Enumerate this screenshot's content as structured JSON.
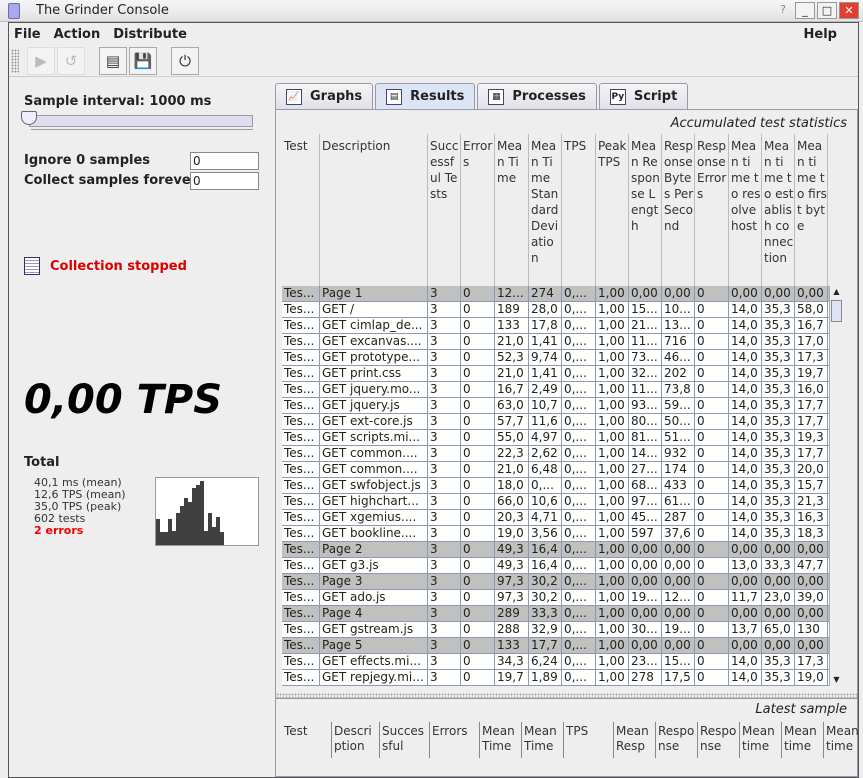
{
  "window": {
    "title": "The Grinder Console"
  },
  "menu": [
    "File",
    "Action",
    "Distribute"
  ],
  "help": "Help",
  "toolbar": [
    {
      "icon": "start-processes-icon",
      "enabled": false
    },
    {
      "icon": "reset-processes-icon",
      "enabled": false
    },
    {
      "icon": "start-recording-icon",
      "enabled": true
    },
    {
      "icon": "save-results-icon",
      "enabled": true
    },
    {
      "icon": "stop-icon",
      "enabled": true
    }
  ],
  "left": {
    "sample_interval": "Sample interval: 1000 ms",
    "slider_level": 0.05,
    "ignore_label": "Ignore 0 samples",
    "ignore_value": "0",
    "collect_label": "Collect samples forever",
    "collect_value": "0",
    "status": "Collection stopped",
    "status_color": "#dd0000",
    "tps": "0,00 TPS",
    "total_label": "Total",
    "stats": [
      "40,1 ms (mean)",
      "12,6 TPS (mean)",
      "35,0 TPS (peak)",
      "602 tests"
    ],
    "errors": "2 errors",
    "histogram": [
      0.4,
      0.2,
      0.2,
      0.4,
      0.22,
      0.5,
      0.6,
      0.72,
      0.66,
      0.88,
      0.92,
      0.98,
      0.22,
      0.5,
      0.28,
      0.43,
      0.2
    ]
  },
  "tabs": [
    {
      "label": "Graphs",
      "icon": "graph-icon"
    },
    {
      "label": "Results",
      "icon": "document-icon",
      "active": true
    },
    {
      "label": "Processes",
      "icon": "processes-icon"
    },
    {
      "label": "Script",
      "icon": "python-script-icon"
    }
  ],
  "results": {
    "caption": "Accumulated test statistics",
    "columns": [
      "Test",
      "Description",
      "Successful Tests",
      "Errors",
      "Mean Time",
      "Mean Time Standard Deviation",
      "TPS",
      "Peak TPS",
      "Mean Response Length",
      "Response Bytes Per Second",
      "Response Errors",
      "Mean time to resolve host",
      "Mean time to establish connection",
      "Mean time to first byte"
    ],
    "rows": [
      [
        "Tes...",
        "Page 1",
        "3",
        "0",
        "12...",
        "274",
        "0,...",
        "1,00",
        "0,00",
        "0,00",
        "0",
        "0,00",
        "0,00",
        "0,00"
      ],
      [
        "Tes...",
        "GET /",
        "3",
        "0",
        "189",
        "28,0",
        "0,...",
        "1,00",
        "15...",
        "10...",
        "0",
        "14,0",
        "35,3",
        "58,0"
      ],
      [
        "Tes...",
        "GET cimlap_de...",
        "3",
        "0",
        "133",
        "17,8",
        "0,...",
        "1,00",
        "21...",
        "13...",
        "0",
        "14,0",
        "35,3",
        "16,7"
      ],
      [
        "Tes...",
        "GET excanvas....",
        "3",
        "0",
        "21,0",
        "1,41",
        "0,...",
        "1,00",
        "11...",
        "716",
        "0",
        "14,0",
        "35,3",
        "17,0"
      ],
      [
        "Tes...",
        "GET prototype...",
        "3",
        "0",
        "52,3",
        "9,74",
        "0,...",
        "1,00",
        "73...",
        "46...",
        "0",
        "14,0",
        "35,3",
        "17,3"
      ],
      [
        "Tes...",
        "GET print.css",
        "3",
        "0",
        "21,0",
        "1,41",
        "0,...",
        "1,00",
        "32...",
        "202",
        "0",
        "14,0",
        "35,3",
        "19,7"
      ],
      [
        "Tes...",
        "GET jquery.mo...",
        "3",
        "0",
        "16,7",
        "2,49",
        "0,...",
        "1,00",
        "11...",
        "73,8",
        "0",
        "14,0",
        "35,3",
        "16,0"
      ],
      [
        "Tes...",
        "GET jquery.js",
        "3",
        "0",
        "63,0",
        "10,7",
        "0,...",
        "1,00",
        "93...",
        "59...",
        "0",
        "14,0",
        "35,3",
        "17,7"
      ],
      [
        "Tes...",
        "GET ext-core.js",
        "3",
        "0",
        "57,7",
        "11,6",
        "0,...",
        "1,00",
        "80...",
        "50...",
        "0",
        "14,0",
        "35,3",
        "17,7"
      ],
      [
        "Tes...",
        "GET scripts.mi...",
        "3",
        "0",
        "55,0",
        "4,97",
        "0,...",
        "1,00",
        "81...",
        "51...",
        "0",
        "14,0",
        "35,3",
        "19,3"
      ],
      [
        "Tes...",
        "GET common....",
        "3",
        "0",
        "22,3",
        "2,62",
        "0,...",
        "1,00",
        "14...",
        "932",
        "0",
        "14,0",
        "35,3",
        "17,7"
      ],
      [
        "Tes...",
        "GET common....",
        "3",
        "0",
        "21,0",
        "6,48",
        "0,...",
        "1,00",
        "27...",
        "174",
        "0",
        "14,0",
        "35,3",
        "20,0"
      ],
      [
        "Tes...",
        "GET swfobject.js",
        "3",
        "0",
        "18,0",
        "0,...",
        "0,...",
        "1,00",
        "68...",
        "433",
        "0",
        "14,0",
        "35,3",
        "15,7"
      ],
      [
        "Tes...",
        "GET highchart...",
        "3",
        "0",
        "66,0",
        "10,6",
        "0,...",
        "1,00",
        "97...",
        "61...",
        "0",
        "14,0",
        "35,3",
        "21,3"
      ],
      [
        "Tes...",
        "GET xgemius....",
        "3",
        "0",
        "20,3",
        "4,71",
        "0,...",
        "1,00",
        "45...",
        "287",
        "0",
        "14,0",
        "35,3",
        "16,3"
      ],
      [
        "Tes...",
        "GET bookline....",
        "3",
        "0",
        "19,0",
        "3,56",
        "0,...",
        "1,00",
        "597",
        "37,6",
        "0",
        "14,0",
        "35,3",
        "18,3"
      ],
      [
        "Tes...",
        "Page 2",
        "3",
        "0",
        "49,3",
        "16,4",
        "0,...",
        "1,00",
        "0,00",
        "0,00",
        "0",
        "0,00",
        "0,00",
        "0,00"
      ],
      [
        "Tes...",
        "GET g3.js",
        "3",
        "0",
        "49,3",
        "16,4",
        "0,...",
        "1,00",
        "0,00",
        "0,00",
        "0",
        "13,0",
        "33,3",
        "47,7"
      ],
      [
        "Tes...",
        "Page 3",
        "3",
        "0",
        "97,3",
        "30,2",
        "0,...",
        "1,00",
        "0,00",
        "0,00",
        "0",
        "0,00",
        "0,00",
        "0,00"
      ],
      [
        "Tes...",
        "GET ado.js",
        "3",
        "0",
        "97,3",
        "30,2",
        "0,...",
        "1,00",
        "19...",
        "12...",
        "0",
        "11,7",
        "23,0",
        "39,0"
      ],
      [
        "Tes...",
        "Page 4",
        "3",
        "0",
        "289",
        "33,3",
        "0,...",
        "1,00",
        "0,00",
        "0,00",
        "0",
        "0,00",
        "0,00",
        "0,00"
      ],
      [
        "Tes...",
        "GET gstream.js",
        "3",
        "0",
        "288",
        "32,9",
        "0,...",
        "1,00",
        "30...",
        "19...",
        "0",
        "13,7",
        "65,0",
        "130"
      ],
      [
        "Tes...",
        "Page 5",
        "3",
        "0",
        "133",
        "17,7",
        "0,...",
        "1,00",
        "0,00",
        "0,00",
        "0",
        "0,00",
        "0,00",
        "0,00"
      ],
      [
        "Tes...",
        "GET effects.mi...",
        "3",
        "0",
        "34,3",
        "6,24",
        "0,...",
        "1,00",
        "23...",
        "15...",
        "0",
        "14,0",
        "35,3",
        "17,3"
      ],
      [
        "Tes...",
        "GET repjegy.mi...",
        "3",
        "0",
        "19,7",
        "1,89",
        "0,...",
        "1,00",
        "278",
        "17,5",
        "0",
        "14,0",
        "35,3",
        "19,0"
      ]
    ]
  },
  "latest": {
    "caption": "Latest sample",
    "columns": [
      "Test",
      "Description",
      "Successful",
      "Errors",
      "Mean Time",
      "Mean Time",
      "TPS",
      "Mean Resp",
      "Response",
      "Response",
      "Mean time",
      "Mean time",
      "Mean time"
    ]
  }
}
